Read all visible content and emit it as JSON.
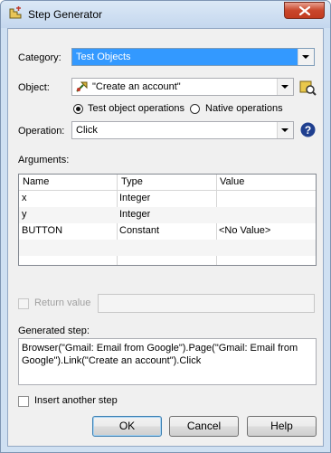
{
  "window": {
    "title": "Step Generator",
    "icons": {
      "app": "step-generator-icon",
      "close": "close-icon"
    }
  },
  "category": {
    "label": "Category:",
    "value": "Test Objects"
  },
  "object": {
    "label": "Object:",
    "value": "\"Create an account\"",
    "icons": {
      "object_type": "link-icon",
      "picker": "object-picker-icon"
    }
  },
  "operation_mode": {
    "options": [
      {
        "label": "Test object operations",
        "checked": true
      },
      {
        "label": "Native operations",
        "checked": false
      }
    ]
  },
  "operation": {
    "label": "Operation:",
    "value": "Click",
    "help_icon": "help-icon"
  },
  "arguments": {
    "label": "Arguments:",
    "columns": [
      "Name",
      "Type",
      "Value"
    ],
    "rows": [
      [
        "x",
        "Integer",
        ""
      ],
      [
        "y",
        "Integer",
        ""
      ],
      [
        "BUTTON",
        "Constant",
        "<No Value>"
      ]
    ]
  },
  "return_value": {
    "label": "Return value",
    "value": "",
    "enabled": false
  },
  "generated_step": {
    "label": "Generated step:",
    "line1": "Browser(\"Gmail: Email from Google\").Page(\"Gmail: Email from",
    "line2": "Google\").Link(\"Create an account\").Click"
  },
  "insert_another": {
    "label": "Insert another step",
    "checked": false
  },
  "buttons": {
    "ok": "OK",
    "cancel": "Cancel",
    "help": "Help"
  }
}
